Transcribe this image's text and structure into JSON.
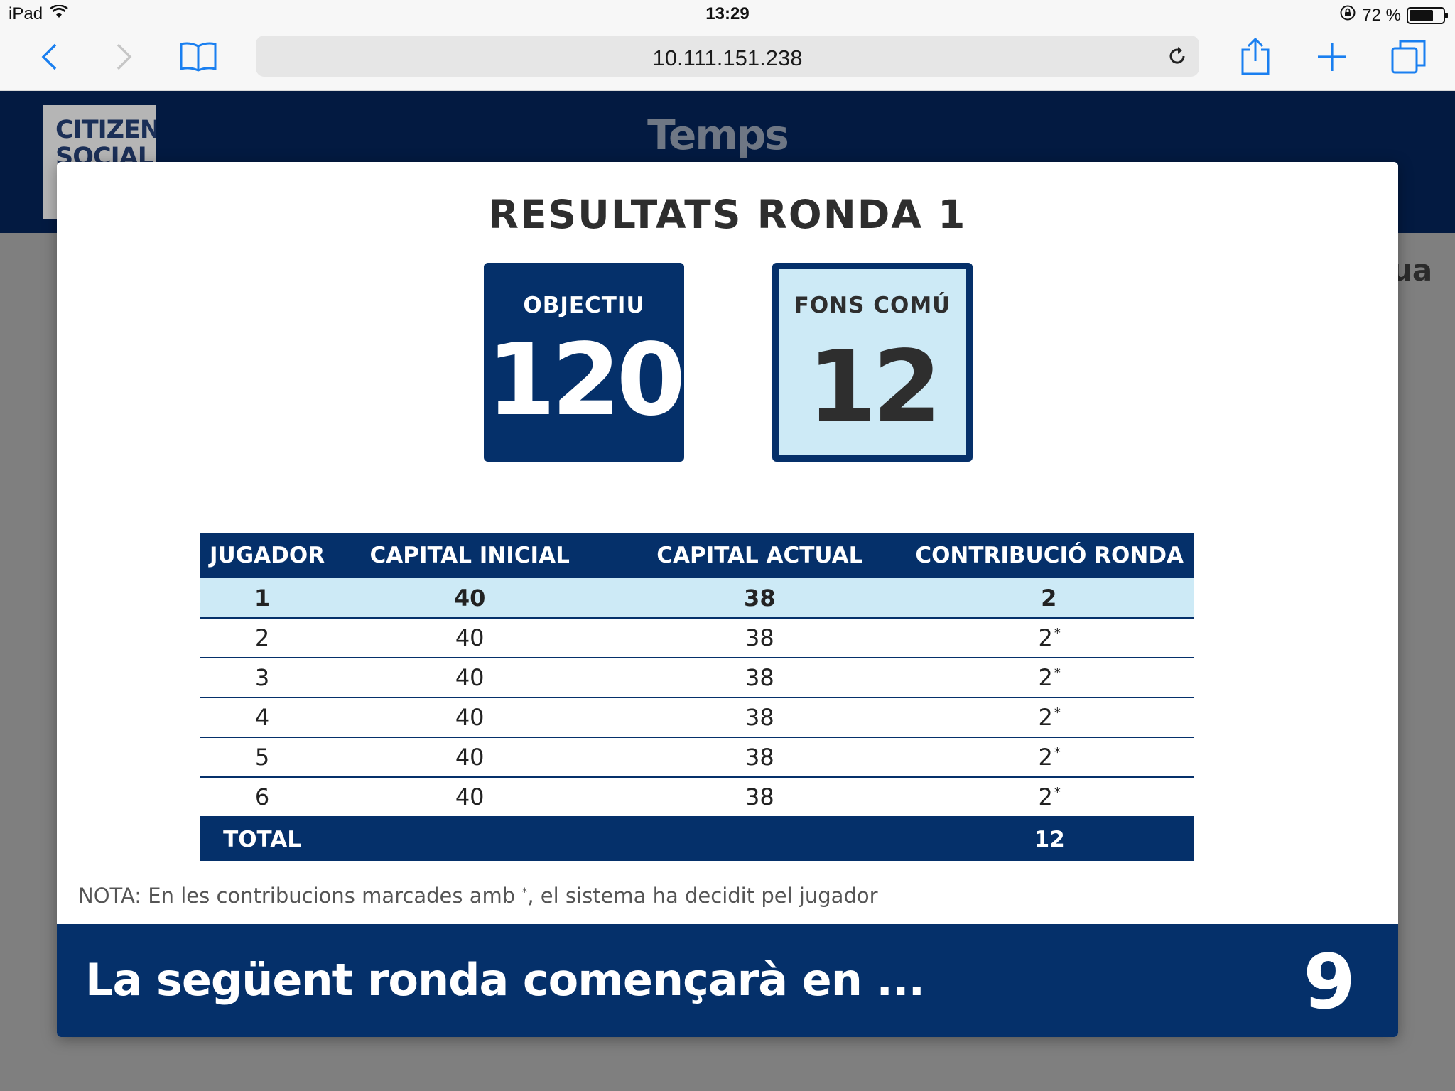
{
  "status_bar": {
    "device": "iPad",
    "time": "13:29",
    "battery": "72 %",
    "battery_level": 0.72,
    "icons": [
      "wifi-icon",
      "orientation-lock-icon",
      "battery-icon"
    ]
  },
  "browser": {
    "url": "10.111.151.238",
    "icons": [
      "back-icon",
      "forward-icon",
      "bookmarks-icon",
      "reload-icon",
      "share-icon",
      "new-tab-icon",
      "tabs-icon"
    ],
    "accent_color": "#1a7ff0"
  },
  "site": {
    "logo_lines": [
      "CITIZEN",
      "SOCIAL"
    ],
    "title": "Temps",
    "background_fragment": "ua"
  },
  "modal": {
    "title": "RESULTATS RONDA 1",
    "objectiu": {
      "label": "OBJECTIU",
      "value": "120"
    },
    "fons_comu": {
      "label": "FONS COMÚ",
      "value": "12"
    },
    "table": {
      "headers": [
        "JUGADOR",
        "CAPITAL INICIAL",
        "CAPITAL ACTUAL",
        "CONTRIBUCIÓ RONDA"
      ],
      "rows": [
        {
          "jugador": "1",
          "capital_inicial": "40",
          "capital_actual": "38",
          "contribucio": "2",
          "marked": "",
          "highlight": true
        },
        {
          "jugador": "2",
          "capital_inicial": "40",
          "capital_actual": "38",
          "contribucio": "2",
          "marked": "*",
          "highlight": false
        },
        {
          "jugador": "3",
          "capital_inicial": "40",
          "capital_actual": "38",
          "contribucio": "2",
          "marked": "*",
          "highlight": false
        },
        {
          "jugador": "4",
          "capital_inicial": "40",
          "capital_actual": "38",
          "contribucio": "2",
          "marked": "*",
          "highlight": false
        },
        {
          "jugador": "5",
          "capital_inicial": "40",
          "capital_actual": "38",
          "contribucio": "2",
          "marked": "*",
          "highlight": false
        },
        {
          "jugador": "6",
          "capital_inicial": "40",
          "capital_actual": "38",
          "contribucio": "2",
          "marked": "*",
          "highlight": false
        }
      ],
      "total_label": "TOTAL",
      "total_value": "12"
    },
    "note": {
      "before": "NOTA: En les contribucions marcades amb ",
      "mark": "*",
      "after": ", el sistema ha decidit pel jugador"
    },
    "footer": {
      "text": "La següent ronda començarà en ...",
      "countdown": "9"
    }
  },
  "colors": {
    "navy": "#05306a",
    "light_blue": "#cdeaf6",
    "header_dark": "#031a41"
  }
}
